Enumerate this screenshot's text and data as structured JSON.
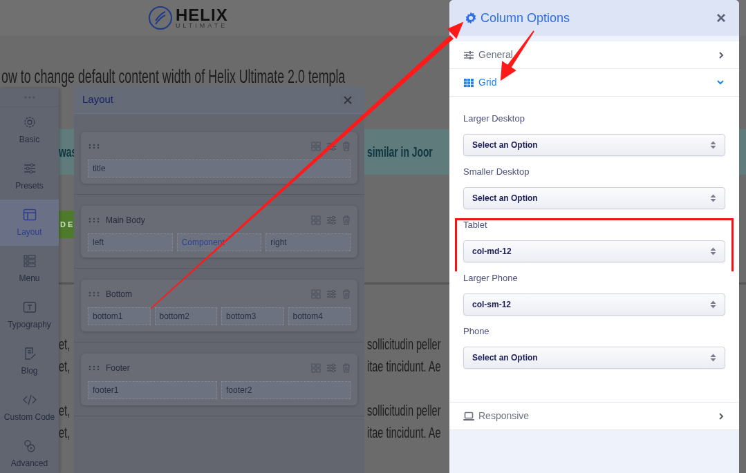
{
  "page": {
    "logo": {
      "name": "HELIX",
      "tagline": "ULTIMATE"
    },
    "heading": "ow to change default content width of Helix Ultimate 2.0 templa",
    "banner_fragments": [
      "was",
      "similar in Joor"
    ],
    "button_fragment": "D E",
    "paragraph_lines": [
      {
        "left": "et,",
        "middle": "sollicitudin peller"
      },
      {
        "left": "et,",
        "middle": "itae tincidunt. Ae"
      },
      {
        "left": "et,",
        "middle": "sollicitudin peller"
      },
      {
        "left": "et,",
        "middle": "itae tincidunt. Ae"
      }
    ]
  },
  "sidebar": {
    "items": [
      {
        "label": "Basic",
        "kind": "gear",
        "selected": false
      },
      {
        "label": "Presets",
        "kind": "sliders",
        "selected": false
      },
      {
        "label": "Layout",
        "kind": "layout",
        "selected": true
      },
      {
        "label": "Menu",
        "kind": "menu",
        "selected": false
      },
      {
        "label": "Typography",
        "kind": "typography",
        "selected": false
      },
      {
        "label": "Blog",
        "kind": "blog",
        "selected": false
      },
      {
        "label": "Custom Code",
        "kind": "code",
        "selected": false
      },
      {
        "label": "Advanced",
        "kind": "advanced",
        "selected": false
      }
    ]
  },
  "layout_panel": {
    "title": "Layout",
    "sections": [
      {
        "columns": [
          {
            "label": "title",
            "highlighted": false
          }
        ]
      },
      {
        "name": "Main Body",
        "columns": [
          {
            "label": "left",
            "highlighted": false
          },
          {
            "label": "Component",
            "highlighted": true
          },
          {
            "label": "right",
            "highlighted": false
          }
        ]
      },
      {
        "name": "Bottom",
        "columns": [
          {
            "label": "bottom1",
            "highlighted": false
          },
          {
            "label": "bottom2",
            "highlighted": false
          },
          {
            "label": "bottom3",
            "highlighted": false
          },
          {
            "label": "bottom4",
            "highlighted": false
          }
        ]
      },
      {
        "name": "Footer",
        "columns": [
          {
            "label": "footer1",
            "highlighted": false
          },
          {
            "label": "footer2",
            "highlighted": false
          }
        ]
      }
    ]
  },
  "column_options": {
    "title": "Column Options",
    "sections": [
      {
        "label": "General",
        "kind": "sliders",
        "expanded": false
      },
      {
        "label": "Grid",
        "kind": "grid",
        "expanded": true,
        "fields": [
          {
            "label": "Larger Desktop",
            "value": "Select an Option",
            "highlighted": false
          },
          {
            "label": "Smaller Desktop",
            "value": "Select an Option",
            "highlighted": false
          },
          {
            "label": "Tablet",
            "value": "col-md-12",
            "highlighted": true
          },
          {
            "label": "Larger Phone",
            "value": "col-sm-12",
            "highlighted": false
          },
          {
            "label": "Phone",
            "value": "Select an Option",
            "highlighted": false
          }
        ]
      },
      {
        "label": "Responsive",
        "kind": "laptop",
        "expanded": false
      }
    ]
  }
}
